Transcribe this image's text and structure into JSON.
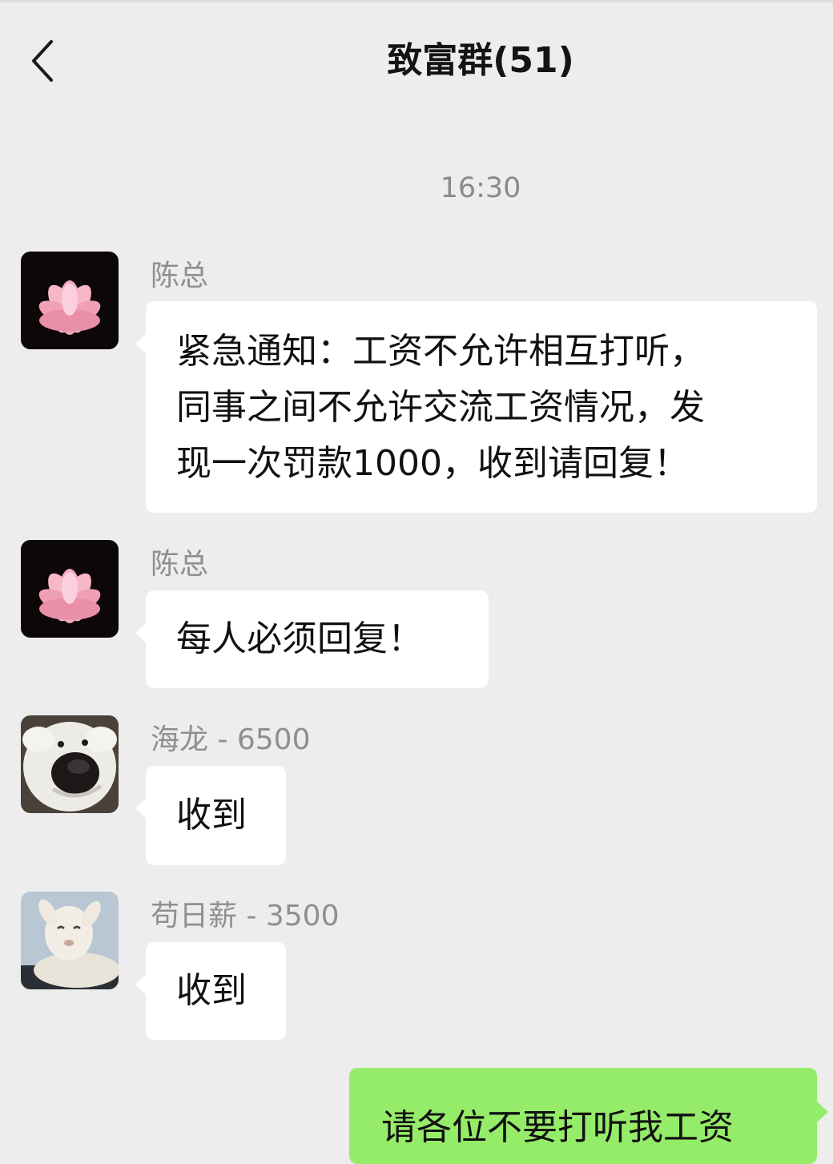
{
  "header": {
    "back_icon": "chevron-left-icon",
    "title": "致富群(51)"
  },
  "timestamp": "16:30",
  "messages": [
    {
      "sender": "陈总",
      "avatar": "lotus-flower-avatar",
      "lines": [
        "紧急通知：工资不允许相互打听，",
        "同事之间不允许交流工资情况，发",
        "现一次罚款1000，收到请回复！"
      ]
    },
    {
      "sender": "陈总",
      "avatar": "lotus-flower-avatar",
      "text": "每人必须回复！"
    },
    {
      "sender": "海龙 - 6500",
      "avatar": "dog-face-avatar",
      "text": "收到"
    },
    {
      "sender": "苟日薪 - 3500",
      "avatar": "lamb-avatar",
      "text": "收到"
    }
  ],
  "outgoing": {
    "text": "请各位不要打听我工资"
  },
  "colors": {
    "background": "#ededed",
    "incoming_bubble": "#ffffff",
    "outgoing_bubble": "#95ec69"
  }
}
